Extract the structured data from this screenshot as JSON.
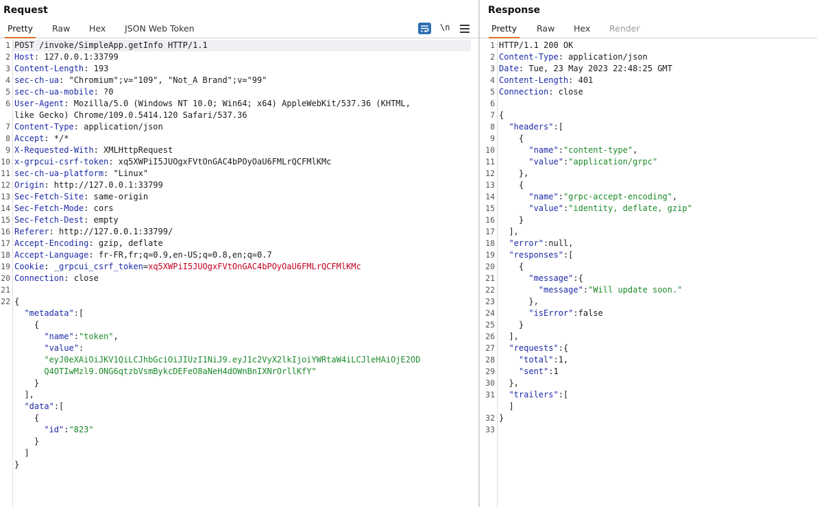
{
  "request": {
    "title": "Request",
    "tabs": [
      "Pretty",
      "Raw",
      "Hex",
      "JSON Web Token"
    ],
    "active_tab": "Pretty",
    "tools": {
      "newline_label": "\\n"
    },
    "lines": [
      {
        "n": "1",
        "parts": [
          [
            "p",
            "POST /invoke/SimpleApp.getInfo HTTP/1.1"
          ]
        ]
      },
      {
        "n": "2",
        "parts": [
          [
            "k",
            "Host"
          ],
          [
            "p",
            ": 127.0.0.1:33799"
          ]
        ]
      },
      {
        "n": "3",
        "parts": [
          [
            "k",
            "Content-Length"
          ],
          [
            "p",
            ": 193"
          ]
        ]
      },
      {
        "n": "4",
        "parts": [
          [
            "k",
            "sec-ch-ua"
          ],
          [
            "p",
            ": \"Chromium\";v=\"109\", \"Not_A Brand\";v=\"99\""
          ]
        ]
      },
      {
        "n": "5",
        "parts": [
          [
            "k",
            "sec-ch-ua-mobile"
          ],
          [
            "p",
            ": ?0"
          ]
        ]
      },
      {
        "n": "6",
        "parts": [
          [
            "k",
            "User-Agent"
          ],
          [
            "p",
            ": Mozilla/5.0 (Windows NT 10.0; Win64; x64) AppleWebKit/537.36 (KHTML,"
          ]
        ]
      },
      {
        "n": "",
        "parts": [
          [
            "p",
            "like Gecko) Chrome/109.0.5414.120 Safari/537.36"
          ]
        ]
      },
      {
        "n": "7",
        "parts": [
          [
            "k",
            "Content-Type"
          ],
          [
            "p",
            ": application/json"
          ]
        ]
      },
      {
        "n": "8",
        "parts": [
          [
            "k",
            "Accept"
          ],
          [
            "p",
            ": */*"
          ]
        ]
      },
      {
        "n": "9",
        "parts": [
          [
            "k",
            "X-Requested-With"
          ],
          [
            "p",
            ": XMLHttpRequest"
          ]
        ]
      },
      {
        "n": "10",
        "parts": [
          [
            "k",
            "x-grpcui-csrf-token"
          ],
          [
            "p",
            ": xq5XWPiI5JUOgxFVtOnGAC4bPOyOaU6FMLrQCFMlKMc"
          ]
        ]
      },
      {
        "n": "11",
        "parts": [
          [
            "k",
            "sec-ch-ua-platform"
          ],
          [
            "p",
            ": \"Linux\""
          ]
        ]
      },
      {
        "n": "12",
        "parts": [
          [
            "k",
            "Origin"
          ],
          [
            "p",
            ": http://127.0.0.1:33799"
          ]
        ]
      },
      {
        "n": "13",
        "parts": [
          [
            "k",
            "Sec-Fetch-Site"
          ],
          [
            "p",
            ": same-origin"
          ]
        ]
      },
      {
        "n": "14",
        "parts": [
          [
            "k",
            "Sec-Fetch-Mode"
          ],
          [
            "p",
            ": cors"
          ]
        ]
      },
      {
        "n": "15",
        "parts": [
          [
            "k",
            "Sec-Fetch-Dest"
          ],
          [
            "p",
            ": empty"
          ]
        ]
      },
      {
        "n": "16",
        "parts": [
          [
            "k",
            "Referer"
          ],
          [
            "p",
            ": http://127.0.0.1:33799/"
          ]
        ]
      },
      {
        "n": "17",
        "parts": [
          [
            "k",
            "Accept-Encoding"
          ],
          [
            "p",
            ": gzip, deflate"
          ]
        ]
      },
      {
        "n": "18",
        "parts": [
          [
            "k",
            "Accept-Language"
          ],
          [
            "p",
            ": fr-FR,fr;q=0.9,en-US;q=0.8,en;q=0.7"
          ]
        ]
      },
      {
        "n": "19",
        "parts": [
          [
            "k",
            "Cookie"
          ],
          [
            "p",
            ": "
          ],
          [
            "k",
            "_grpcui_csrf_token"
          ],
          [
            "p",
            "="
          ],
          [
            "c",
            "xq5XWPiI5JUOgxFVtOnGAC4bPOyOaU6FMLrQCFMlKMc"
          ]
        ]
      },
      {
        "n": "20",
        "parts": [
          [
            "k",
            "Connection"
          ],
          [
            "p",
            ": close"
          ]
        ]
      },
      {
        "n": "21",
        "parts": []
      },
      {
        "n": "22",
        "parts": [
          [
            "p",
            "{"
          ]
        ]
      },
      {
        "n": "",
        "parts": [
          [
            "p",
            "  "
          ],
          [
            "k",
            "\"metadata\""
          ],
          [
            "p",
            ":["
          ]
        ]
      },
      {
        "n": "",
        "parts": [
          [
            "p",
            "    {"
          ]
        ]
      },
      {
        "n": "",
        "parts": [
          [
            "p",
            "      "
          ],
          [
            "k",
            "\"name\""
          ],
          [
            "p",
            ":"
          ],
          [
            "s",
            "\"token\""
          ],
          [
            "p",
            ","
          ]
        ]
      },
      {
        "n": "",
        "parts": [
          [
            "p",
            "      "
          ],
          [
            "k",
            "\"value\""
          ],
          [
            "p",
            ":"
          ]
        ]
      },
      {
        "n": "",
        "parts": [
          [
            "p",
            "      "
          ],
          [
            "s",
            "\"eyJ0eXAiOiJKV1QiLCJhbGciOiJIUzI1NiJ9.eyJ1c2VyX2lkIjoiYWRtaW4iLCJleHAiOjE2OD"
          ]
        ]
      },
      {
        "n": "",
        "parts": [
          [
            "p",
            "      "
          ],
          [
            "s",
            "Q4OTIwMzl9.ONG6qtzbVsmBykcDEFeO8aNeH4dOWnBnIXNrOrllKfY\""
          ]
        ]
      },
      {
        "n": "",
        "parts": [
          [
            "p",
            "    }"
          ]
        ]
      },
      {
        "n": "",
        "parts": [
          [
            "p",
            "  ],"
          ]
        ]
      },
      {
        "n": "",
        "parts": [
          [
            "p",
            "  "
          ],
          [
            "k",
            "\"data\""
          ],
          [
            "p",
            ":["
          ]
        ]
      },
      {
        "n": "",
        "parts": [
          [
            "p",
            "    {"
          ]
        ]
      },
      {
        "n": "",
        "parts": [
          [
            "p",
            "      "
          ],
          [
            "k",
            "\"id\""
          ],
          [
            "p",
            ":"
          ],
          [
            "s",
            "\"823\""
          ]
        ]
      },
      {
        "n": "",
        "parts": [
          [
            "p",
            "    }"
          ]
        ]
      },
      {
        "n": "",
        "parts": [
          [
            "p",
            "  ]"
          ]
        ]
      },
      {
        "n": "",
        "parts": [
          [
            "p",
            "}"
          ]
        ]
      }
    ]
  },
  "response": {
    "title": "Response",
    "tabs": [
      "Pretty",
      "Raw",
      "Hex",
      "Render"
    ],
    "active_tab": "Pretty",
    "lines": [
      {
        "n": "1",
        "parts": [
          [
            "p",
            "HTTP/1.1 200 OK"
          ]
        ]
      },
      {
        "n": "2",
        "parts": [
          [
            "k",
            "Content-Type"
          ],
          [
            "p",
            ": application/json"
          ]
        ]
      },
      {
        "n": "3",
        "parts": [
          [
            "k",
            "Date"
          ],
          [
            "p",
            ": Tue, 23 May 2023 22:48:25 GMT"
          ]
        ]
      },
      {
        "n": "4",
        "parts": [
          [
            "k",
            "Content-Length"
          ],
          [
            "p",
            ": 401"
          ]
        ]
      },
      {
        "n": "5",
        "parts": [
          [
            "k",
            "Connection"
          ],
          [
            "p",
            ": close"
          ]
        ]
      },
      {
        "n": "6",
        "parts": []
      },
      {
        "n": "7",
        "parts": [
          [
            "p",
            "{"
          ]
        ]
      },
      {
        "n": "8",
        "parts": [
          [
            "p",
            "  "
          ],
          [
            "k",
            "\"headers\""
          ],
          [
            "p",
            ":["
          ]
        ]
      },
      {
        "n": "9",
        "parts": [
          [
            "p",
            "    {"
          ]
        ]
      },
      {
        "n": "10",
        "parts": [
          [
            "p",
            "      "
          ],
          [
            "k",
            "\"name\""
          ],
          [
            "p",
            ":"
          ],
          [
            "s",
            "\"content-type\""
          ],
          [
            "p",
            ","
          ]
        ]
      },
      {
        "n": "11",
        "parts": [
          [
            "p",
            "      "
          ],
          [
            "k",
            "\"value\""
          ],
          [
            "p",
            ":"
          ],
          [
            "s",
            "\"application/grpc\""
          ]
        ]
      },
      {
        "n": "12",
        "parts": [
          [
            "p",
            "    },"
          ]
        ]
      },
      {
        "n": "13",
        "parts": [
          [
            "p",
            "    {"
          ]
        ]
      },
      {
        "n": "14",
        "parts": [
          [
            "p",
            "      "
          ],
          [
            "k",
            "\"name\""
          ],
          [
            "p",
            ":"
          ],
          [
            "s",
            "\"grpc-accept-encoding\""
          ],
          [
            "p",
            ","
          ]
        ]
      },
      {
        "n": "15",
        "parts": [
          [
            "p",
            "      "
          ],
          [
            "k",
            "\"value\""
          ],
          [
            "p",
            ":"
          ],
          [
            "s",
            "\"identity, deflate, gzip\""
          ]
        ]
      },
      {
        "n": "16",
        "parts": [
          [
            "p",
            "    }"
          ]
        ]
      },
      {
        "n": "17",
        "parts": [
          [
            "p",
            "  ],"
          ]
        ]
      },
      {
        "n": "18",
        "parts": [
          [
            "p",
            "  "
          ],
          [
            "k",
            "\"error\""
          ],
          [
            "p",
            ":null,"
          ]
        ]
      },
      {
        "n": "19",
        "parts": [
          [
            "p",
            "  "
          ],
          [
            "k",
            "\"responses\""
          ],
          [
            "p",
            ":["
          ]
        ]
      },
      {
        "n": "20",
        "parts": [
          [
            "p",
            "    {"
          ]
        ]
      },
      {
        "n": "21",
        "parts": [
          [
            "p",
            "      "
          ],
          [
            "k",
            "\"message\""
          ],
          [
            "p",
            ":{"
          ]
        ]
      },
      {
        "n": "22",
        "parts": [
          [
            "p",
            "        "
          ],
          [
            "k",
            "\"message\""
          ],
          [
            "p",
            ":"
          ],
          [
            "s",
            "\"Will update soon.\""
          ]
        ]
      },
      {
        "n": "23",
        "parts": [
          [
            "p",
            "      },"
          ]
        ]
      },
      {
        "n": "24",
        "parts": [
          [
            "p",
            "      "
          ],
          [
            "k",
            "\"isError\""
          ],
          [
            "p",
            ":false"
          ]
        ]
      },
      {
        "n": "25",
        "parts": [
          [
            "p",
            "    }"
          ]
        ]
      },
      {
        "n": "26",
        "parts": [
          [
            "p",
            "  ],"
          ]
        ]
      },
      {
        "n": "27",
        "parts": [
          [
            "p",
            "  "
          ],
          [
            "k",
            "\"requests\""
          ],
          [
            "p",
            ":{"
          ]
        ]
      },
      {
        "n": "28",
        "parts": [
          [
            "p",
            "    "
          ],
          [
            "k",
            "\"total\""
          ],
          [
            "p",
            ":1,"
          ]
        ]
      },
      {
        "n": "29",
        "parts": [
          [
            "p",
            "    "
          ],
          [
            "k",
            "\"sent\""
          ],
          [
            "p",
            ":1"
          ]
        ]
      },
      {
        "n": "30",
        "parts": [
          [
            "p",
            "  },"
          ]
        ]
      },
      {
        "n": "31",
        "parts": [
          [
            "p",
            "  "
          ],
          [
            "k",
            "\"trailers\""
          ],
          [
            "p",
            ":["
          ]
        ]
      },
      {
        "n": "",
        "parts": [
          [
            "p",
            "  ]"
          ]
        ]
      },
      {
        "n": "32",
        "parts": [
          [
            "p",
            "}"
          ]
        ]
      },
      {
        "n": "33",
        "parts": []
      }
    ]
  },
  "colors": {
    "key": "#1c2aa8",
    "string": "#1b8a2a",
    "cookie_value": "#c4001f",
    "active_tab_underline": "#e06a2c",
    "wrap_button": "#2c6fb3"
  },
  "icons": [
    "text-wrap-icon",
    "menu-icon"
  ]
}
